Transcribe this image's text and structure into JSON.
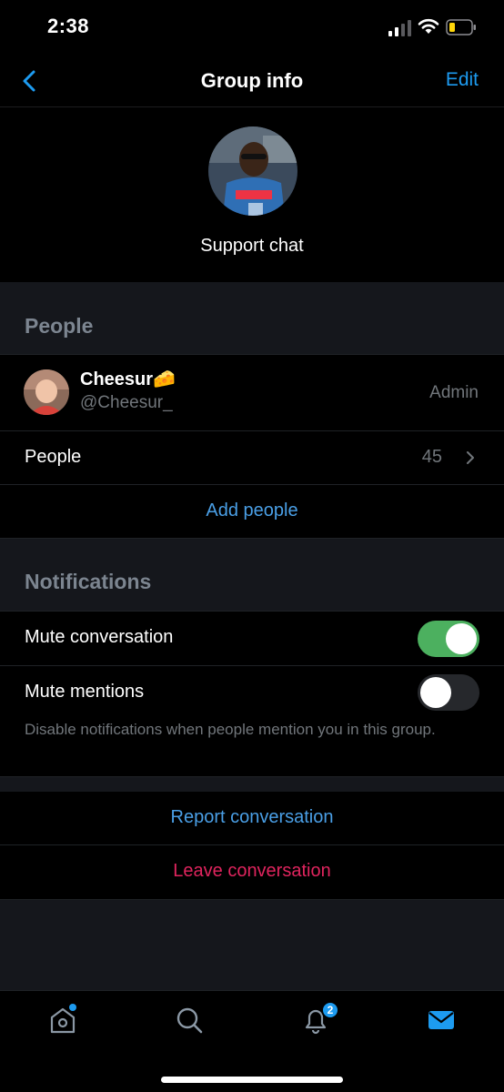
{
  "status": {
    "time": "2:38"
  },
  "nav": {
    "title": "Group info",
    "edit_label": "Edit"
  },
  "group": {
    "name": "Support chat"
  },
  "people_section": {
    "heading": "People",
    "member": {
      "name": "Cheesur🧀",
      "handle": "@Cheesur_",
      "role": "Admin"
    },
    "people_label": "People",
    "people_count": "45",
    "add_people_label": "Add people"
  },
  "notifications_section": {
    "heading": "Notifications",
    "mute_conversation_label": "Mute conversation",
    "mute_conversation_on": true,
    "mute_mentions_label": "Mute mentions",
    "mute_mentions_on": false,
    "helper_text": "Disable notifications when people mention you in this group."
  },
  "actions": {
    "report_label": "Report conversation",
    "leave_label": "Leave conversation"
  },
  "tab_bar": {
    "tabs": [
      "home-icon",
      "search-icon",
      "bell-icon",
      "mail-icon"
    ],
    "notification_badge": "2",
    "active_tab": "mail-icon"
  },
  "colors": {
    "accent": "#1d9bf0",
    "toggle_on": "#4cb05f",
    "danger": "#e0245e"
  }
}
